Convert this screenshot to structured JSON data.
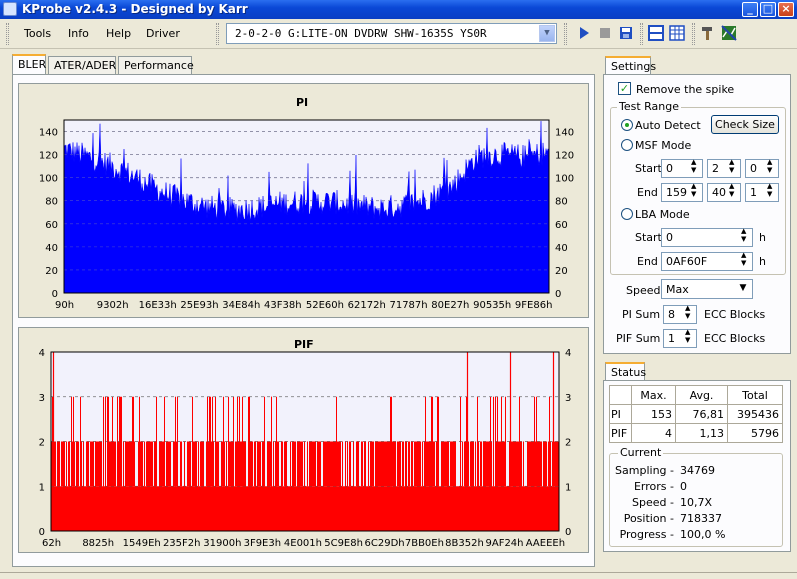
{
  "window": {
    "title": "KProbe v2.4.3 - Designed by Karr",
    "controls": [
      "_",
      "□",
      "×"
    ]
  },
  "menu": {
    "items": [
      {
        "label": "Tools"
      },
      {
        "label": "Info"
      },
      {
        "label": "Help"
      },
      {
        "label": "Driver"
      }
    ]
  },
  "drive": {
    "selected": "2-0-2-0 G:LITE-ON DVDRW SHW-1635S  YS0R"
  },
  "tabs": [
    {
      "label": "BLER",
      "active": true
    },
    {
      "label": "ATER/ADER",
      "active": false
    },
    {
      "label": "Performance",
      "active": false
    }
  ],
  "pi_chart": {
    "title": "PI",
    "y_ticks": [
      "0",
      "20",
      "40",
      "60",
      "80",
      "100",
      "120",
      "140"
    ],
    "x_ticks": [
      "90h",
      "9302h",
      "16E33h",
      "25E93h",
      "34E84h",
      "43F38h",
      "52E60h",
      "62172h",
      "71787h",
      "80E27h",
      "90535h",
      "9FE86h"
    ],
    "color": "#0000ff"
  },
  "pif_chart": {
    "title": "PIF",
    "y_ticks": [
      "0",
      "1",
      "2",
      "3",
      "4"
    ],
    "x_ticks": [
      "62h",
      "8825h",
      "1549Eh",
      "235F2h",
      "31900h",
      "3F9E3h",
      "4E001h",
      "5C9E8h",
      "6C29Dh",
      "7BB0Eh",
      "8B352h",
      "9AF24h",
      "AAEEEh"
    ],
    "color": "#ff0000"
  },
  "chart_data": [
    {
      "type": "bar",
      "title": "PI",
      "x_tick_labels": [
        "90h",
        "9302h",
        "16E33h",
        "25E93h",
        "34E84h",
        "43F38h",
        "52E60h",
        "62172h",
        "71787h",
        "80E27h",
        "90535h",
        "9FE86h"
      ],
      "ylim": [
        0,
        150
      ],
      "grid": true,
      "envelope": [
        {
          "pos": 0.0,
          "value": 125
        },
        {
          "pos": 0.05,
          "value": 118
        },
        {
          "pos": 0.1,
          "value": 110
        },
        {
          "pos": 0.15,
          "value": 100
        },
        {
          "pos": 0.2,
          "value": 88
        },
        {
          "pos": 0.25,
          "value": 80
        },
        {
          "pos": 0.3,
          "value": 74
        },
        {
          "pos": 0.35,
          "value": 72
        },
        {
          "pos": 0.4,
          "value": 74
        },
        {
          "pos": 0.45,
          "value": 78
        },
        {
          "pos": 0.5,
          "value": 79
        },
        {
          "pos": 0.55,
          "value": 79
        },
        {
          "pos": 0.6,
          "value": 76
        },
        {
          "pos": 0.65,
          "value": 73
        },
        {
          "pos": 0.7,
          "value": 76
        },
        {
          "pos": 0.75,
          "value": 82
        },
        {
          "pos": 0.8,
          "value": 92
        },
        {
          "pos": 0.85,
          "value": 118
        },
        {
          "pos": 0.9,
          "value": 120
        },
        {
          "pos": 0.95,
          "value": 118
        },
        {
          "pos": 1.0,
          "value": 122
        }
      ],
      "max": 153
    },
    {
      "type": "bar",
      "title": "PIF",
      "x_tick_labels": [
        "62h",
        "8825h",
        "1549Eh",
        "235F2h",
        "31900h",
        "3F9E3h",
        "4E001h",
        "5C9E8h",
        "6C29Dh",
        "7BB0Eh",
        "8B352h",
        "9AF24h",
        "AAEEEh"
      ],
      "ylim": [
        0,
        4
      ],
      "grid": true,
      "baseline_value": 1,
      "level2_density": 0.75,
      "level3_count": 60,
      "level4_positions": [
        0.005,
        0.82,
        0.905,
        0.99
      ],
      "max": 4
    }
  ],
  "settings": {
    "title": "Settings",
    "remove_spike": {
      "label": "Remove the spike",
      "checked": true
    },
    "test_range": {
      "label": "Test Range",
      "auto_detect": "Auto Detect",
      "check_size": "Check Size",
      "msf_mode": "MSF Mode",
      "start_label": "Start",
      "end_label": "End",
      "msf_start": [
        "0",
        "2",
        "0"
      ],
      "msf_end": [
        "159",
        "40",
        "1"
      ],
      "lba_mode": "LBA Mode",
      "lba_start": "0",
      "lba_end": "0AF60F",
      "unit": "h"
    },
    "speed_label": "Speed",
    "speed_value": "Max",
    "pi_sum_label": "PI Sum",
    "pi_sum_value": "8",
    "pif_sum_label": "PIF Sum",
    "pif_sum_value": "1",
    "ecc_blocks": "ECC Blocks"
  },
  "status": {
    "title": "Status",
    "headers": [
      "",
      "Max.",
      "Avg.",
      "Total"
    ],
    "rows": [
      [
        "PI",
        "153",
        "76,81",
        "395436"
      ],
      [
        "PIF",
        "4",
        "1,13",
        "5796"
      ]
    ],
    "current_label": "Current",
    "current": [
      {
        "label": "Sampling -",
        "value": "34769"
      },
      {
        "label": "Errors -",
        "value": "0"
      },
      {
        "label": "Speed -",
        "value": "10,7X"
      },
      {
        "label": "Position -",
        "value": "718337"
      },
      {
        "label": "Progress -",
        "value": "100,0 %"
      }
    ]
  }
}
